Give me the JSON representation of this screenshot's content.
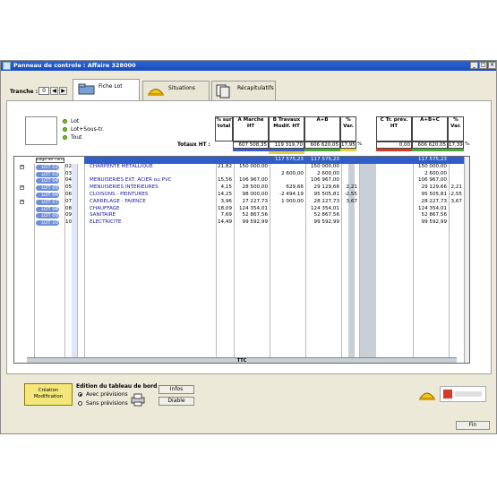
{
  "window": {
    "title": "Panneau de controle : Affaire 328000"
  },
  "toolbar": {
    "tranche_label": "Tranche :",
    "tranche_value": "0"
  },
  "tabs": [
    {
      "label": "Fiche Lot",
      "active": true
    },
    {
      "label": "Situations",
      "active": false
    },
    {
      "label": "Récapitulatifs",
      "active": false
    }
  ],
  "filters": [
    {
      "label": "Lot"
    },
    {
      "label": "Lot+Sous-tr."
    },
    {
      "label": "Tout"
    }
  ],
  "table": {
    "headers": {
      "pct_total": "% sur total",
      "a": "A Marché HT",
      "b": "B Travaux Modif. HT",
      "apb": "A+B",
      "var1": "% Var.",
      "c": "C Tr. prév. HT",
      "apbpc": "A+B+C",
      "var2": "% Var."
    },
    "totals_label": "Totaux HT :",
    "totals": {
      "a": "607 508,35",
      "b": "119 319,70",
      "apb": "606 620,05",
      "var1": "17,95",
      "var1_unit": "%",
      "c": "0,00",
      "apbpc": "606 620,05",
      "var2": "17,39",
      "var2_unit": "%"
    },
    "top_row": {
      "logo": "Logo de l'affaire",
      "apb": "117 575,23",
      "apb2": "117 575,23",
      "apbpc": "117 575,23"
    },
    "rows": [
      {
        "lot": "LOT 02",
        "code": "02",
        "libelle": "CHARPENTE METALLIQUE",
        "pct": "21,82",
        "a": "150 000,00",
        "b": "",
        "apb": "150 000,00",
        "var": "",
        "apbpc": "150 000,00",
        "var2": ""
      },
      {
        "lot": "LOT 03",
        "code": "03",
        "libelle": "",
        "pct": "",
        "a": "",
        "b": "2 600,00",
        "apb": "2 600,00",
        "var": "",
        "apbpc": "2 600,00",
        "var2": ""
      },
      {
        "lot": "LOT 04",
        "code": "04",
        "libelle": "MENUISERIES EXT. ACIER ou PVC",
        "pct": "15,56",
        "a": "106 967,00",
        "b": "",
        "apb": "106 967,00",
        "var": "",
        "apbpc": "106 967,00",
        "var2": ""
      },
      {
        "lot": "LOT 05",
        "code": "05",
        "libelle": "MENUISERIES INTERIEURES",
        "pct": "4,15",
        "a": "28 500,00",
        "b": "629,66",
        "apb": "29 129,66",
        "var": "2,21",
        "apbpc": "29 129,66",
        "var2": "2,21"
      },
      {
        "lot": "LOT 06",
        "code": "06",
        "libelle": "CLOISONS - PEINTURES",
        "pct": "14,25",
        "a": "98 000,00",
        "b": "-2 494,19",
        "apb": "95 505,81",
        "var": "-2,55",
        "apbpc": "95 505,81",
        "var2": "-2,55"
      },
      {
        "lot": "LOT 07",
        "code": "07",
        "libelle": "CARRELAGE - FAIENCE",
        "pct": "3,96",
        "a": "27 227,73",
        "b": "1 000,00",
        "apb": "28 227,73",
        "var": "3,67",
        "apbpc": "28 227,73",
        "var2": "3,67"
      },
      {
        "lot": "LOT 08",
        "code": "08",
        "libelle": "CHAUFFAGE",
        "pct": "18,09",
        "a": "124 354,01",
        "b": "",
        "apb": "124 354,01",
        "var": "",
        "apbpc": "124 354,01",
        "var2": ""
      },
      {
        "lot": "LOT 09",
        "code": "09",
        "libelle": "SANITAIRE",
        "pct": "7,69",
        "a": "52 867,56",
        "b": "",
        "apb": "52 867,56",
        "var": "",
        "apbpc": "52 867,56",
        "var2": ""
      },
      {
        "lot": "LOT 10",
        "code": "10",
        "libelle": "ELECTRICITE",
        "pct": "14,49",
        "a": "99 592,99",
        "b": "",
        "apb": "99 592,99",
        "var": "",
        "apbpc": "99 592,99",
        "var2": ""
      }
    ],
    "footer_label": "TTC"
  },
  "bottom": {
    "creation_btn": "Création Modification",
    "edition_title": "Edition du tableau de bord",
    "radio_with": "Avec prévisions",
    "radio_without": "Sans prévisions",
    "infos_btn": "Infos",
    "diable_btn": "Diable",
    "fin_btn": "Fin"
  },
  "colors": {
    "titlebar": "#1a4cb8",
    "selection": "#2f5ec8",
    "bar_blue": "#3a5fc8",
    "bar_yellow": "#e8d23a",
    "bar_green": "#4fa83a",
    "bar_red": "#d83a2a"
  }
}
